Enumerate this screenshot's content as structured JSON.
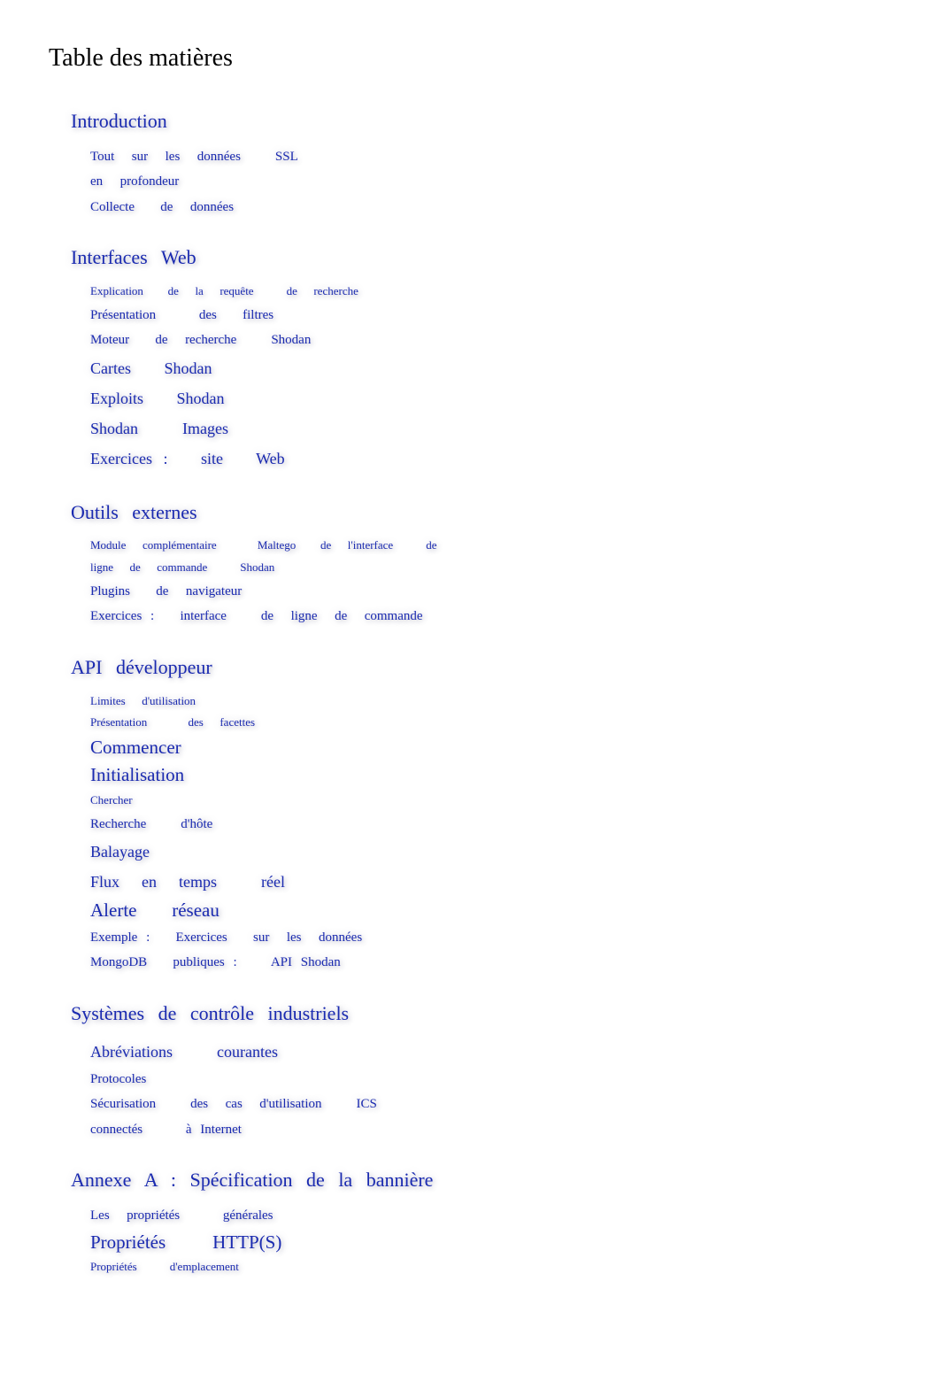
{
  "title": "Table des matières",
  "sections": [
    {
      "heading": "Introduction",
      "items": [
        {
          "label": "Tout  sur  les  données    SSL",
          "size": "md"
        },
        {
          "label": "en  profondeur",
          "size": "md"
        },
        {
          "label": "Collecte   de  données",
          "size": "md"
        }
      ]
    },
    {
      "heading": "Interfaces    Web",
      "items": [
        {
          "label": "Explication   de  la  requête    de  recherche",
          "size": "sm"
        },
        {
          "label": "Présentation     des   filtres",
          "size": "md"
        },
        {
          "label": "Moteur   de  recherche    Shodan",
          "size": "md"
        },
        {
          "label": "Cartes   Shodan",
          "size": "lg"
        },
        {
          "label": "Exploits   Shodan",
          "size": "lg"
        },
        {
          "label": "Shodan    Images",
          "size": "lg"
        },
        {
          "label": "Exercices :   site   Web",
          "size": "lg"
        }
      ]
    },
    {
      "heading": "Outils  externes",
      "items": [
        {
          "label": "Module  complémentaire     Maltego   de  l'interface    de",
          "size": "sm"
        },
        {
          "label": "ligne  de  commande    Shodan",
          "size": "sm"
        },
        {
          "label": "Plugins   de  navigateur",
          "size": "md"
        },
        {
          "label": "Exercices :   interface    de  ligne  de  commande",
          "size": "md"
        }
      ]
    },
    {
      "heading": "API développeur",
      "items": [
        {
          "label": "Limites  d'utilisation",
          "size": "sm"
        },
        {
          "label": "Présentation     des  facettes",
          "size": "sm"
        },
        {
          "label": "Commencer",
          "size": "xl"
        },
        {
          "label": "Initialisation",
          "size": "xl"
        },
        {
          "label": "Chercher",
          "size": "sm"
        },
        {
          "label": "Recherche    d'hôte",
          "size": "md"
        },
        {
          "label": "Balayage",
          "size": "lg"
        },
        {
          "label": "Flux  en  temps    réel",
          "size": "lg"
        },
        {
          "label": "Alerte   réseau",
          "size": "xl"
        },
        {
          "label": "Exemple :   Exercices   sur  les  données",
          "size": "md"
        },
        {
          "label": "MongoDB   publiques :    API Shodan",
          "size": "md"
        }
      ]
    },
    {
      "heading": "Systèmes   de  contrôle    industriels",
      "items": [
        {
          "label": "Abréviations    courantes",
          "size": "lg"
        },
        {
          "label": "Protocoles",
          "size": "md"
        },
        {
          "label": "Sécurisation    des  cas  d'utilisation    ICS",
          "size": "md"
        },
        {
          "label": "connectés     à Internet",
          "size": "md"
        }
      ]
    },
    {
      "heading": "Annexe   A : Spécification    de  la  bannière",
      "items": [
        {
          "label": "Les  propriétés     générales",
          "size": "md"
        },
        {
          "label": "Propriétés    HTTP(S)",
          "size": "xl"
        },
        {
          "label": "Propriétés    d'emplacement",
          "size": "sm"
        }
      ]
    }
  ]
}
